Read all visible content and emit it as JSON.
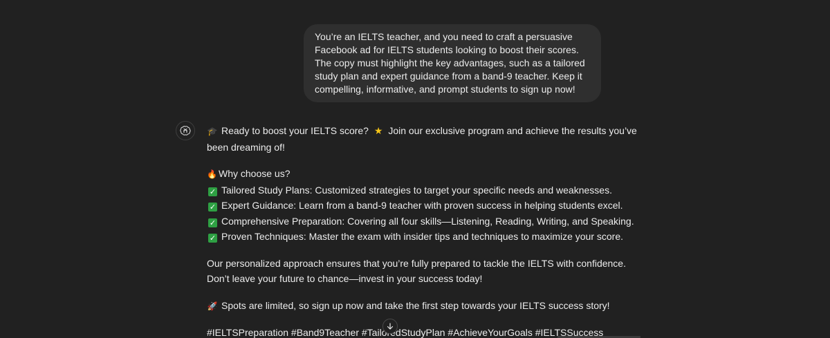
{
  "user_message": {
    "text": "You’re an IELTS teacher, and you need to craft a persuasive Facebook ad for IELTS students looking to boost their scores. The copy must highlight the key advantages, such as a tailored study plan and expert guidance from a band-9 teacher. Keep it compelling, informative, and prompt students to sign up now!"
  },
  "assistant": {
    "avatar_icon": "openai-logo-icon",
    "intro_emoji": "🎓",
    "intro_text_1": "Ready to boost your IELTS score?",
    "intro_star": "★",
    "intro_text_2": "Join our exclusive program and achieve the results you’ve",
    "intro_text_3": "been dreaming of!",
    "why_emoji": "🔥",
    "why_heading": "Why choose us?",
    "check_glyph": "✓",
    "benefits": [
      "Tailored Study Plans: Customized strategies to target your specific needs and weaknesses.",
      "Expert Guidance: Learn from a band-9 teacher with proven success in helping students excel.",
      "Comprehensive Preparation: Covering all four skills—Listening, Reading, Writing, and Speaking.",
      "Proven Techniques: Master the exam with insider tips and techniques to maximize your score."
    ],
    "approach_line_1": "Our personalized approach ensures that you’re fully prepared to tackle the IELTS with confidence.",
    "approach_line_2": "Don’t leave your future to chance—invest in your success today!",
    "cta_emoji": "🚀",
    "cta_text": "Spots are limited, so sign up now and take the first step towards your IELTS success story!",
    "hashtags": "#IELTSPreparation #Band9Teacher #TailoredStudyPlan #AchieveYourGoals #IELTSSuccess"
  },
  "controls": {
    "scroll_down_icon": "arrow-down-icon"
  }
}
